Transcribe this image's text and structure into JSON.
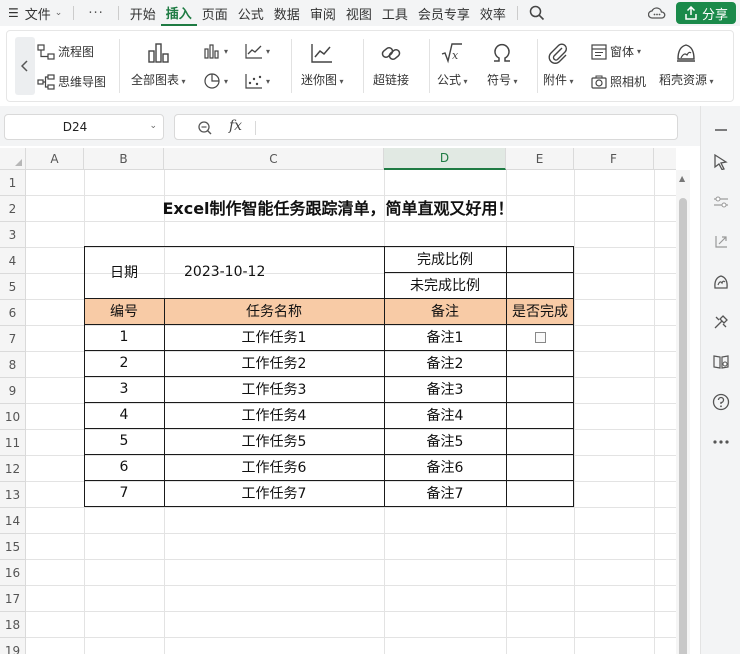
{
  "menubar": {
    "file": "文件",
    "more": "···",
    "tabs": [
      "开始",
      "插入",
      "页面",
      "公式",
      "数据",
      "审阅",
      "视图",
      "工具",
      "会员专享",
      "效率"
    ],
    "active_tab": "插入",
    "share": "分享"
  },
  "ribbon": {
    "flowchart": "流程图",
    "mindmap": "思维导图",
    "all_charts": "全部图表",
    "sparkline": "迷你图",
    "hyperlink": "超链接",
    "formula": "公式",
    "symbol": "符号",
    "attachment": "附件",
    "window": "窗体",
    "camera": "照相机",
    "shell_resources": "稻壳资源"
  },
  "formula_bar": {
    "name_box": "D24",
    "fx": "fx",
    "value": ""
  },
  "sheet": {
    "columns": [
      "A",
      "B",
      "C",
      "D",
      "E",
      "F"
    ],
    "selected_column": "D",
    "rows": [
      "1",
      "2",
      "3",
      "4",
      "5",
      "6",
      "7",
      "8",
      "9",
      "10",
      "11",
      "12",
      "13",
      "14",
      "15",
      "16",
      "17",
      "18",
      "19"
    ],
    "title": "Excel制作智能任务跟踪清单，简单直观又好用！",
    "date_label": "日期",
    "date_value": "2023-10-12",
    "done_ratio_label": "完成比例",
    "undone_ratio_label": "未完成比例",
    "headers": [
      "编号",
      "任务名称",
      "备注",
      "是否完成"
    ],
    "tasks": [
      {
        "no": "1",
        "name": "工作任务1",
        "note": "备注1",
        "has_checkbox": true
      },
      {
        "no": "2",
        "name": "工作任务2",
        "note": "备注2",
        "has_checkbox": false
      },
      {
        "no": "3",
        "name": "工作任务3",
        "note": "备注3",
        "has_checkbox": false
      },
      {
        "no": "4",
        "name": "工作任务4",
        "note": "备注4",
        "has_checkbox": false
      },
      {
        "no": "5",
        "name": "工作任务5",
        "note": "备注5",
        "has_checkbox": false
      },
      {
        "no": "6",
        "name": "工作任务6",
        "note": "备注6",
        "has_checkbox": false
      },
      {
        "no": "7",
        "name": "工作任务7",
        "note": "备注7",
        "has_checkbox": false
      }
    ]
  },
  "colors": {
    "accent": "#1e7b43",
    "header_fill": "#f8cba6",
    "share_button": "#1a8a4a"
  }
}
